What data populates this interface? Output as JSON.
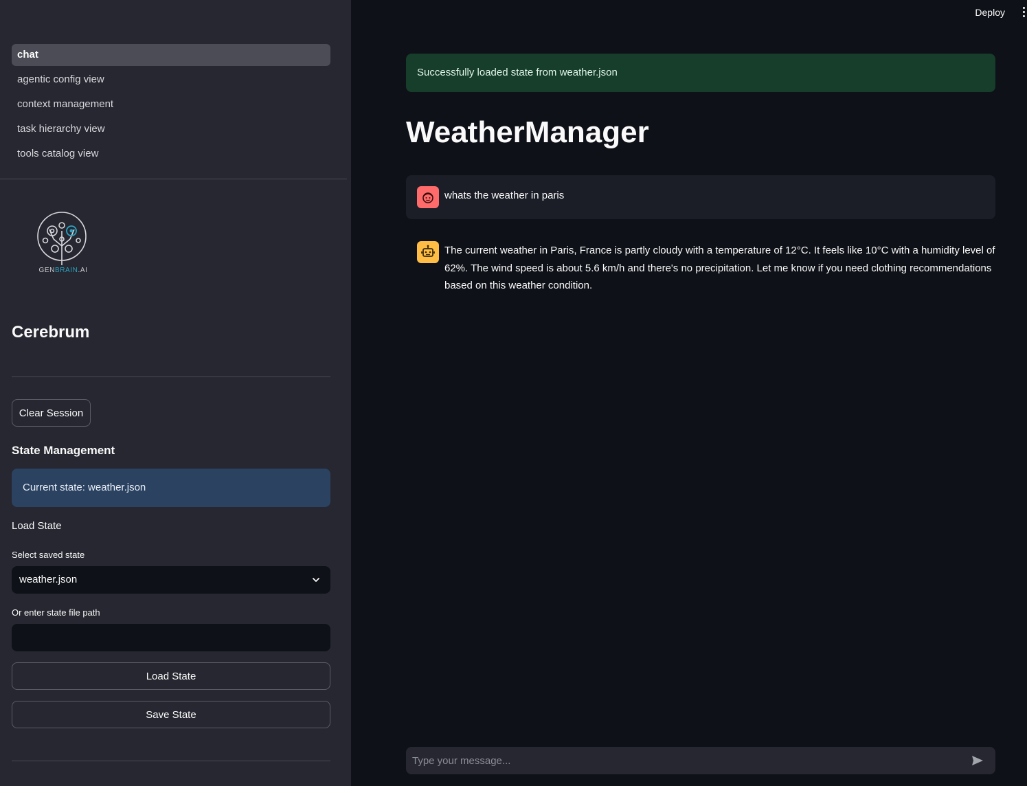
{
  "sidebar": {
    "nav": [
      {
        "label": "chat",
        "active": true
      },
      {
        "label": "agentic config view"
      },
      {
        "label": "context management"
      },
      {
        "label": "task hierarchy view"
      },
      {
        "label": "tools catalog view"
      }
    ],
    "logo": {
      "prefix": "GEN",
      "accent": "BRAIN",
      "suffix": ".AI",
      "accent_color": "#2aa4c4"
    },
    "brand_title": "Cerebrum",
    "clear_session_label": "Clear Session",
    "state_management_title": "State Management",
    "current_state_text": "Current state: weather.json",
    "load_state_title": "Load State",
    "select_label": "Select saved state",
    "select_value": "weather.json",
    "path_label": "Or enter state file path",
    "path_value": "",
    "load_button_label": "Load State",
    "save_button_label": "Save State"
  },
  "header": {
    "deploy_label": "Deploy"
  },
  "main": {
    "success_message": "Successfully loaded state from weather.json",
    "title": "WeatherManager",
    "messages": [
      {
        "role": "user",
        "icon": "user-face-icon",
        "text": "whats the weather in paris"
      },
      {
        "role": "assistant",
        "icon": "robot-icon",
        "text": "The current weather in Paris, France is partly cloudy with a temperature of 12°C. It feels like 10°C with a humidity level of 62%. The wind speed is about 5.6 km/h and there's no precipitation. Let me know if you need clothing recommendations based on this weather condition."
      }
    ],
    "chat_placeholder": "Type your message..."
  },
  "colors": {
    "sidebar_bg": "#262730",
    "main_bg": "#0e1117",
    "success_bg": "#173d2b",
    "info_bg": "#2b4260",
    "user_avatar": "#ff6b6b",
    "bot_avatar": "#ffbd45"
  }
}
